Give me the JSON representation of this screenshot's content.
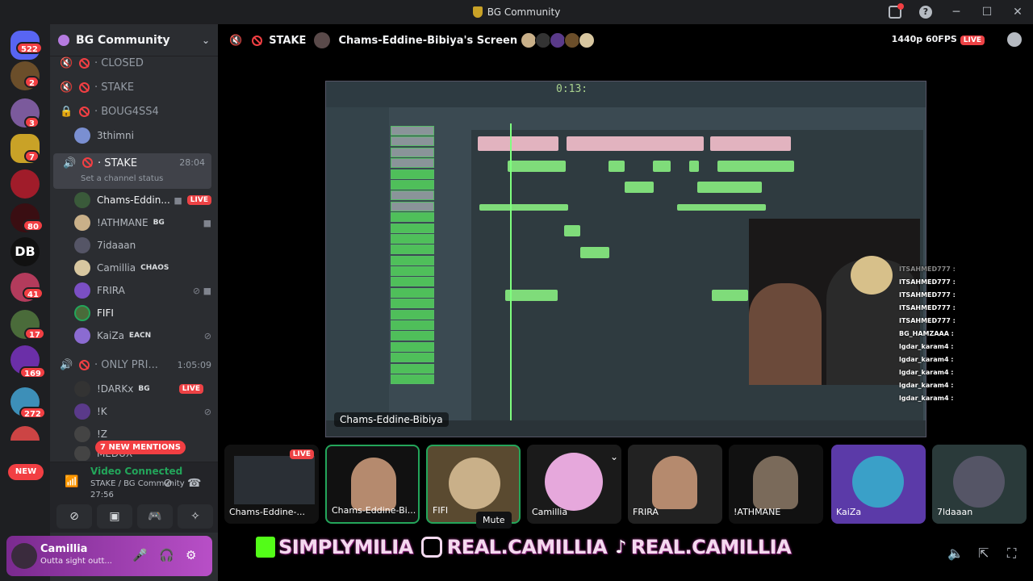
{
  "window": {
    "title": "BG Community"
  },
  "rail": {
    "badges": [
      "522",
      "2",
      "3",
      "7",
      "80",
      "41",
      "17",
      "169",
      "272"
    ],
    "new_label": "NEW"
  },
  "sidebar": {
    "guild": "BG Community",
    "channels": [
      {
        "name": "CLOSED"
      },
      {
        "name": "STAKE"
      },
      {
        "name": "BOUG4SS4"
      }
    ],
    "loose_user": "3thimni",
    "active": {
      "name": "STAKE",
      "time": "28:04",
      "status": "Set a channel status"
    },
    "members": [
      {
        "name": "Chams-Eddin...",
        "live": "LIVE"
      },
      {
        "name": "!ATHMANE",
        "tag": "BG"
      },
      {
        "name": "7idaaan"
      },
      {
        "name": "Camillia",
        "tag": "CHAOS"
      },
      {
        "name": "FRIRA"
      },
      {
        "name": "FIFI"
      },
      {
        "name": "KaiZa",
        "tag": "EACN"
      }
    ],
    "second": {
      "name": "ONLY PRI...",
      "time": "1:05:09"
    },
    "members2": [
      {
        "name": "!DARKx",
        "tag": "BG",
        "live": "LIVE"
      },
      {
        "name": "!K"
      },
      {
        "name": "!Z"
      },
      {
        "name": "MEDUX"
      }
    ],
    "mentions": "7 NEW MENTIONS"
  },
  "voice": {
    "status": "Video Connected",
    "path": "STAKE / BG Community",
    "time": "27:56"
  },
  "user": {
    "name": "Camillia",
    "status": "Outta sight outt..."
  },
  "header": {
    "channel": "STAKE",
    "screen": "Chams-Eddine-Bibiya's Screen",
    "quality": "1440p 60FPS",
    "live": "LIVE"
  },
  "stream": {
    "clock": "0:13:",
    "name": "Chams-Eddine-Bibiya"
  },
  "chat": [
    "ITSAHMED777 :",
    "ITSAHMED777 :",
    "ITSAHMED777 :",
    "ITSAHMED777 :",
    "ITSAHMED777 :",
    "BG_HAMZAAA :",
    "lgdar_karam4 :",
    "lgdar_karam4 :",
    "lgdar_karam4 :",
    "lgdar_karam4 :",
    "lgdar_karam4 :",
    "lgdar_karam4 :"
  ],
  "tiles": [
    {
      "label": "Chams-Eddine-...",
      "live": "LIVE"
    },
    {
      "label": "Chams-Eddine-Bi..."
    },
    {
      "label": "FIFI"
    },
    {
      "label": "Camillia"
    },
    {
      "label": "FRIRA"
    },
    {
      "label": "!ATHMANE"
    },
    {
      "label": "KaiZa"
    },
    {
      "label": "7ldaaan"
    }
  ],
  "tooltip": "Mute",
  "overlay": {
    "kick": "SIMPLYMILIA",
    "ig": "REAL.CAMILLIA",
    "tiktok": "REAL.CAMILLIA"
  }
}
